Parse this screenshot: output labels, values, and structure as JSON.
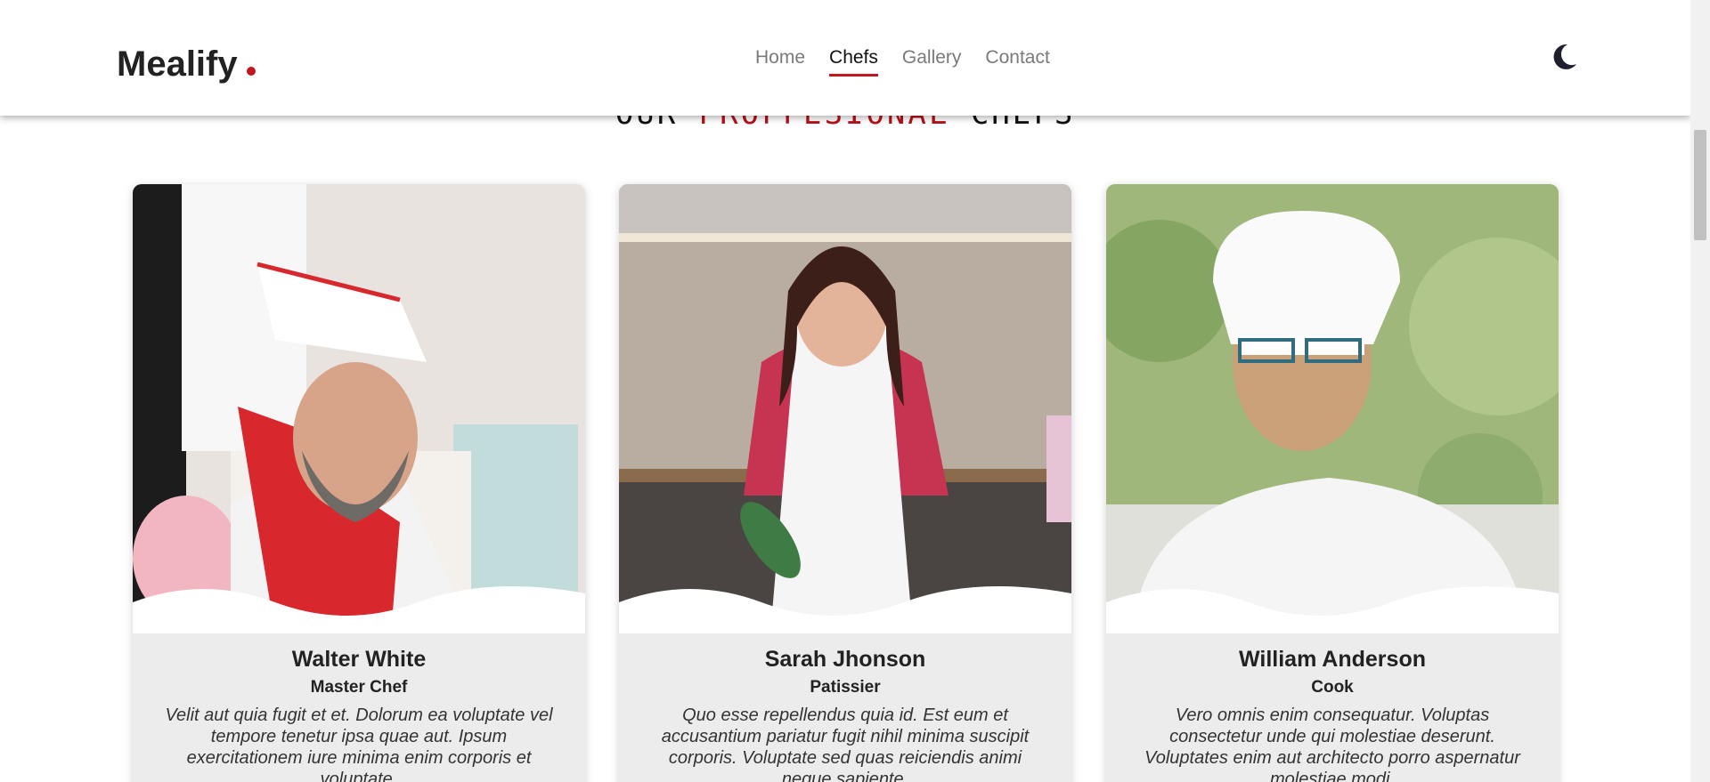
{
  "brand": {
    "name": "Mealify",
    "dot_color": "#c4161c"
  },
  "nav": {
    "items": [
      {
        "label": "Home"
      },
      {
        "label": "Chefs"
      },
      {
        "label": "Gallery"
      },
      {
        "label": "Contact"
      }
    ],
    "active": "Chefs"
  },
  "theme_toggle": {
    "icon": "moon-icon"
  },
  "section": {
    "title_part1": "OUR ",
    "title_accent": "PROFFESIONAL",
    "title_part2": " CHEFS",
    "accent_color": "#b5121b"
  },
  "chefs": [
    {
      "name": "Walter White",
      "role": "Master Chef",
      "description": "Velit aut quia fugit et et. Dolorum ea voluptate vel tempore tenetur ipsa quae aut. Ipsum exercitationem iure minima enim corporis et voluptate."
    },
    {
      "name": "Sarah Jhonson",
      "role": "Patissier",
      "description": "Quo esse repellendus quia id. Est eum et accusantium pariatur fugit nihil minima suscipit corporis. Voluptate sed quas reiciendis animi neque sapiente."
    },
    {
      "name": "William Anderson",
      "role": "Cook",
      "description": "Vero omnis enim consequatur. Voluptas consectetur unde qui molestiae deserunt. Voluptates enim aut architecto porro aspernatur molestiae modi."
    }
  ]
}
